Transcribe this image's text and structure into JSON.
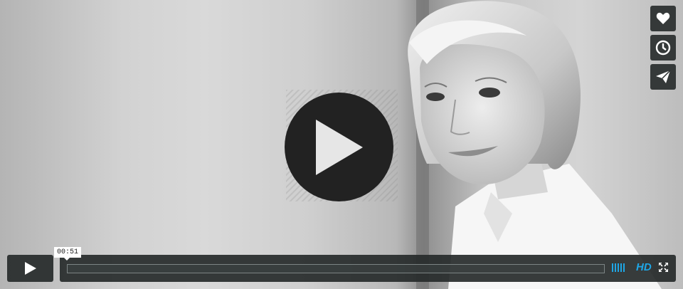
{
  "player": {
    "time_tooltip": "00:51",
    "hd_label": "HD",
    "progress_fraction": 0.0,
    "volume_level": 1.0,
    "accent_color": "#1ea6e6"
  },
  "side_buttons": [
    {
      "icon": "heart-icon"
    },
    {
      "icon": "clock-icon"
    },
    {
      "icon": "paper-plane-icon"
    }
  ],
  "icons": {
    "big_play": "play-icon",
    "control_play": "play-icon",
    "fullscreen": "fullscreen-icon"
  }
}
